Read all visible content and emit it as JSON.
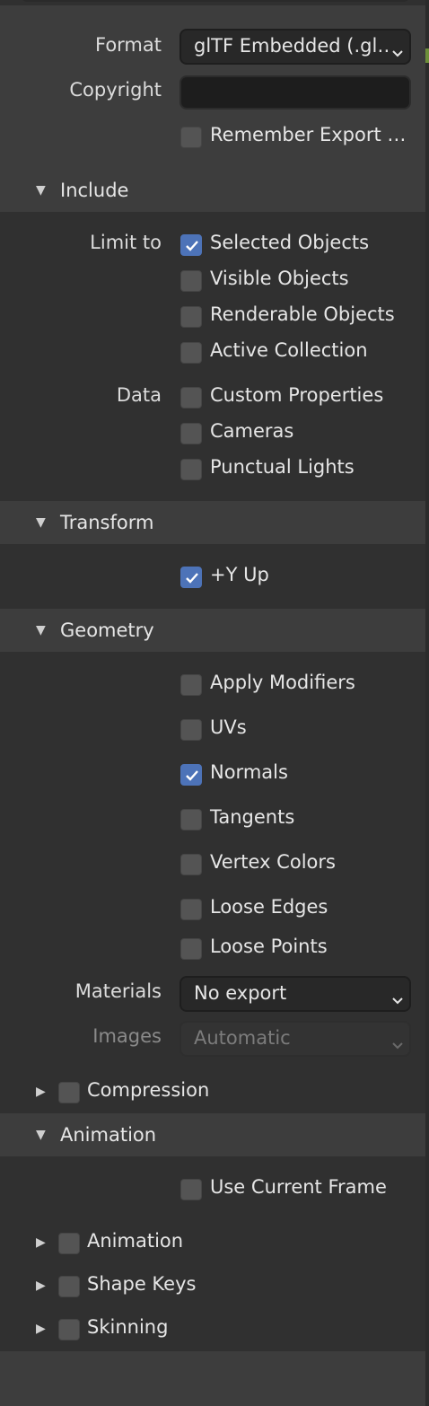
{
  "format": {
    "label": "Format",
    "value": "glTF Embedded (.gl…"
  },
  "copyright": {
    "label": "Copyright",
    "value": ""
  },
  "remember_export": {
    "label": "Remember Export …",
    "checked": false
  },
  "include": {
    "title": "Include",
    "limit_to_label": "Limit to",
    "selected_objects": {
      "label": "Selected Objects",
      "checked": true
    },
    "visible_objects": {
      "label": "Visible Objects",
      "checked": false
    },
    "renderable_objects": {
      "label": "Renderable Objects",
      "checked": false
    },
    "active_collection": {
      "label": "Active Collection",
      "checked": false
    },
    "data_label": "Data",
    "custom_properties": {
      "label": "Custom Properties",
      "checked": false
    },
    "cameras": {
      "label": "Cameras",
      "checked": false
    },
    "punctual_lights": {
      "label": "Punctual Lights",
      "checked": false
    }
  },
  "transform": {
    "title": "Transform",
    "y_up": {
      "label": "+Y Up",
      "checked": true
    }
  },
  "geometry": {
    "title": "Geometry",
    "apply_modifiers": {
      "label": "Apply Modifiers",
      "checked": false
    },
    "uvs": {
      "label": "UVs",
      "checked": false
    },
    "normals": {
      "label": "Normals",
      "checked": true
    },
    "tangents": {
      "label": "Tangents",
      "checked": false
    },
    "vertex_colors": {
      "label": "Vertex Colors",
      "checked": false
    },
    "loose_edges": {
      "label": "Loose Edges",
      "checked": false
    },
    "loose_points": {
      "label": "Loose Points",
      "checked": false
    },
    "materials": {
      "label": "Materials",
      "value": "No export"
    },
    "images": {
      "label": "Images",
      "value": "Automatic",
      "disabled": true
    }
  },
  "compression": {
    "title": "Compression",
    "checked": false
  },
  "animation": {
    "title": "Animation",
    "use_current_frame": {
      "label": "Use Current Frame",
      "checked": false
    },
    "animation_sub": {
      "label": "Animation",
      "checked": false
    },
    "shape_keys": {
      "label": "Shape Keys",
      "checked": false
    },
    "skinning": {
      "label": "Skinning",
      "checked": false
    }
  },
  "icons": {
    "expanded": "triangle-down-icon",
    "collapsed": "triangle-right-icon",
    "dropdown": "chevron-down-icon",
    "check": "check-icon"
  },
  "colors": {
    "panel_bg": "#3d3d3d",
    "section_bg": "#303030",
    "checkbox_on": "#4d73b8",
    "checkbox_off": "#545454"
  }
}
